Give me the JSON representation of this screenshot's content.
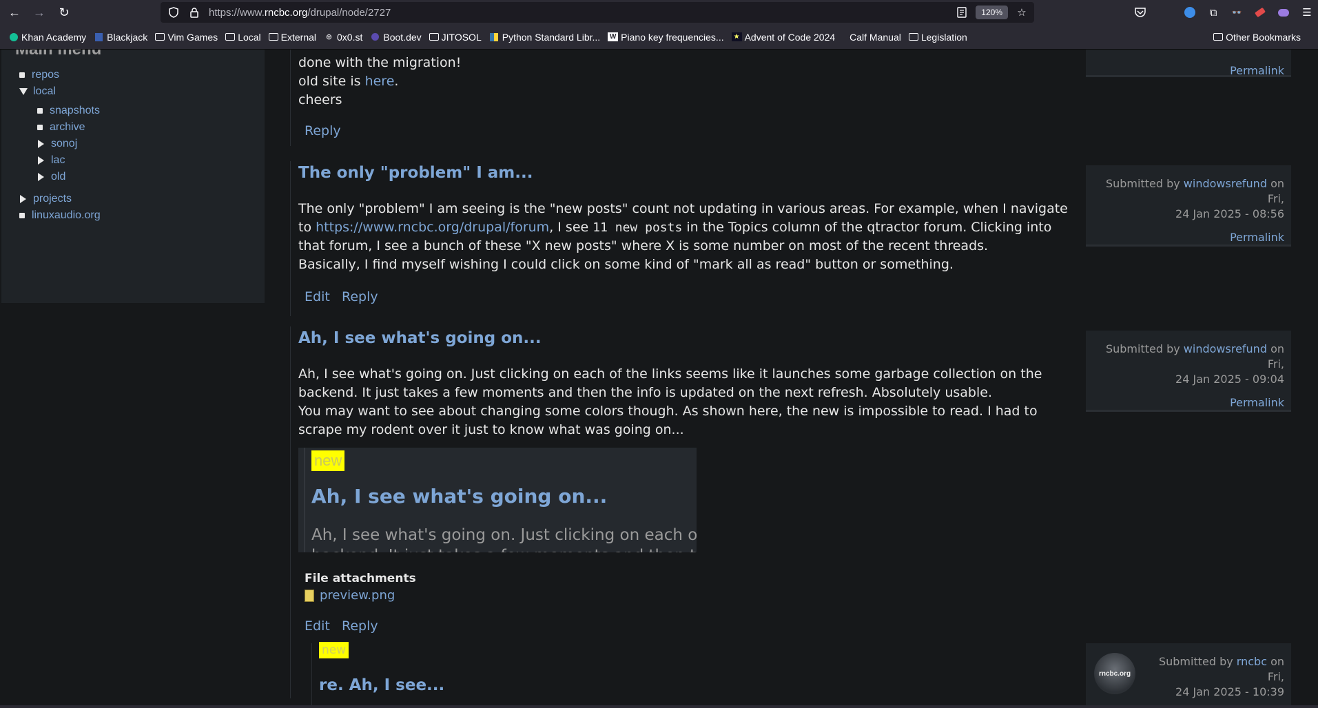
{
  "browser": {
    "url_prefix": "https://www.",
    "url_domain": "rncbc.org",
    "url_path": "/drupal/node/2727",
    "zoom": "120%"
  },
  "bookmarks": [
    {
      "label": "Khan Academy",
      "icon": "khan-icon"
    },
    {
      "label": "Blackjack",
      "icon": "blackjack-icon"
    },
    {
      "label": "Vim Games",
      "icon": "folder-icon"
    },
    {
      "label": "Local",
      "icon": "folder-icon"
    },
    {
      "label": "External",
      "icon": "folder-icon"
    },
    {
      "label": "0x0.st",
      "icon": "globe-icon"
    },
    {
      "label": "Boot.dev",
      "icon": "bootdev-icon"
    },
    {
      "label": "JITOSOL",
      "icon": "folder-icon"
    },
    {
      "label": "Python Standard Libr...",
      "icon": "python-icon"
    },
    {
      "label": "Piano key frequencies...",
      "icon": "wikipedia-icon"
    },
    {
      "label": "Advent of Code 2024",
      "icon": "aoc-icon"
    },
    {
      "label": "Calf Manual",
      "icon": "blank-icon"
    },
    {
      "label": "Legislation",
      "icon": "folder-icon"
    }
  ],
  "other_bookmarks": "Other Bookmarks",
  "sidebar": {
    "title": "Main menu",
    "items": {
      "repos": "repos",
      "local": "local",
      "snapshots": "snapshots",
      "archive": "archive",
      "sonoj": "sonoj",
      "lac": "lac",
      "old": "old",
      "projects": "projects",
      "linuxaudio": "linuxaudio.org"
    }
  },
  "comment0": {
    "line1": "done with the migration!",
    "line2_pre": "old site is ",
    "line2_link": "here",
    "line2_post": ".",
    "line3": "cheers",
    "reply": "Reply",
    "permalink": "Permalink"
  },
  "comment1": {
    "title": "The only \"problem\" I am...",
    "p1_pre": "The only \"problem\" I am seeing is the \"new posts\" count not updating in various areas. For example, when I navigate to",
    "p1_link": "https://www.rncbc.org/drupal/forum",
    "p1_mid": ", I see ",
    "p1_code": "11 new posts",
    "p1_post": " in the Topics column of the qtractor forum. Clicking into that forum, I see a bunch of these \"X new posts\" where X is some number on most of the recent threads.",
    "p2": "Basically, I find myself wishing I could click on some kind of \"mark all as read\" button or something.",
    "edit": "Edit",
    "reply": "Reply",
    "submitted_by": "Submitted by ",
    "author": "windowsrefund",
    "on": " on Fri,",
    "date": "24 Jan 2025 - 08:56",
    "permalink": "Permalink"
  },
  "comment2": {
    "title": "Ah, I see what's going on...",
    "p1": "Ah, I see what's going on. Just clicking on each of the links seems like it launches some garbage collection on the backend. It just takes a few moments and then the info is updated on the next refresh. Absolutely usable.",
    "p2": "You may want to see about changing some colors though. As shown here, the new is impossible to read. I had to scrape my rodent over it just to know what was going on...",
    "preview_new": "new",
    "preview_title": "Ah, I see what's going on...",
    "preview_text1": "Ah, I see what's going on. Just clicking on each of the",
    "preview_text2": "backend. It just takes a few moments and then the i",
    "attachments_title": "File attachments",
    "attachment_name": "preview.png",
    "edit": "Edit",
    "reply": "Reply",
    "submitted_by": "Submitted by ",
    "author": "windowsrefund",
    "on": " on Fri,",
    "date": "24 Jan 2025 - 09:04",
    "permalink": "Permalink"
  },
  "comment3": {
    "new": "new",
    "title": "re. Ah, I see...",
    "submitted_by": "Submitted by ",
    "author": "rncbc",
    "on": " on Fri,",
    "date": "24 Jan 2025 - 10:39",
    "avatar_text": "rncbc.org"
  }
}
